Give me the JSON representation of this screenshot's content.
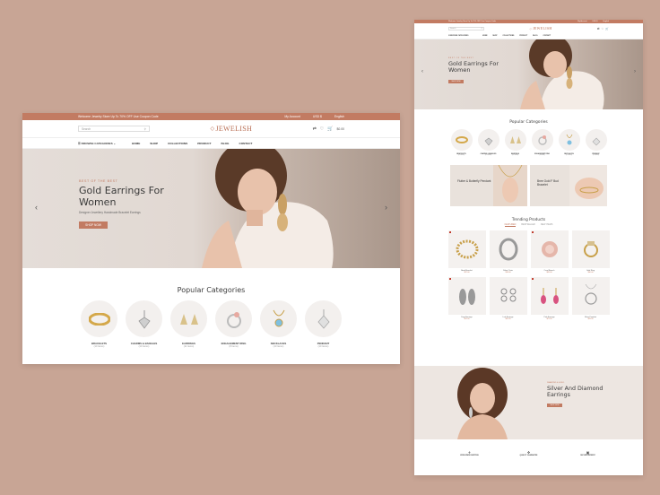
{
  "colors": {
    "background": "#c8a595",
    "accent": "#c27b62"
  },
  "desktop": {
    "topbar": {
      "promo": "Welcome Jewelry Store Up To 70% OFF Use Coupon Code",
      "account": "My Account",
      "currency": "USD $",
      "language": "English"
    },
    "search_placeholder": "Search",
    "logo": "JEWELISH",
    "cart_total": "$0.00",
    "browse_categories": "BROWSE CATEGORIES",
    "nav": [
      "HOME",
      "SHOP",
      "COLLECTIONS",
      "PRODUCT",
      "BLOG",
      "CONTACT"
    ],
    "hero": {
      "tag": "BEST OF THE BEST",
      "title": "Gold Earrings For Women",
      "subtitle": "Designer Jewellery Handmade Bracelet Earrings",
      "button": "SHOP NOW"
    },
    "popular_title": "Popular Categories",
    "categories": [
      {
        "name": "BRACELETS",
        "count": "(10 Items)",
        "icon": "bracelet-icon"
      },
      {
        "name": "CHARMS & BANGLES",
        "count": "(10 Items)",
        "icon": "charm-icon"
      },
      {
        "name": "EARRINGS",
        "count": "(11 Items)",
        "icon": "earring-icon"
      },
      {
        "name": "ENGAGEMENT RING",
        "count": "(8 Items)",
        "icon": "ring-icon"
      },
      {
        "name": "NECKLACES",
        "count": "(10 Items)",
        "icon": "necklace-icon"
      },
      {
        "name": "PENDANT",
        "count": "(10 Items)",
        "icon": "pendant-icon"
      }
    ]
  },
  "mobile": {
    "hero": {
      "tag": "BEST OF THE BEST",
      "title": "Gold Earrings For Women",
      "button": "SHOP NOW"
    },
    "banners": [
      {
        "title": "Flutter & Butterfly Pendant"
      },
      {
        "title": "Bree Gold F Bud Bracelet"
      }
    ],
    "trending_title": "Trending Products",
    "tabs": [
      "FEATURED",
      "BESTSELLER",
      "NEW ITEMS"
    ],
    "products": [
      {
        "name": "Bead Bracelet",
        "price": "$22.00",
        "sale": true
      },
      {
        "name": "Silver Chain",
        "price": "$18.00",
        "sale": false
      },
      {
        "name": "Coral Brooch",
        "price": "$26.00",
        "sale": true
      },
      {
        "name": "Gold Ring",
        "price": "$30.00",
        "sale": false
      },
      {
        "name": "Drop Earrings",
        "price": "$24.00",
        "sale": true
      },
      {
        "name": "Link Earrings",
        "price": "$20.00",
        "sale": false
      },
      {
        "name": "Pink Earrings",
        "price": "$21.00",
        "sale": true
      },
      {
        "name": "Silver Pendant",
        "price": "$28.00",
        "sale": false
      }
    ],
    "promo": {
      "tag": "DIAMOND & GOLD",
      "title": "Silver And Diamond Earrings",
      "button": "SHOP NOW"
    },
    "features": [
      {
        "title": "WORLDWIDE SHIPPING"
      },
      {
        "title": "QUALITY GUARANTEE"
      },
      {
        "title": "SECURE PAYMENT"
      }
    ]
  }
}
